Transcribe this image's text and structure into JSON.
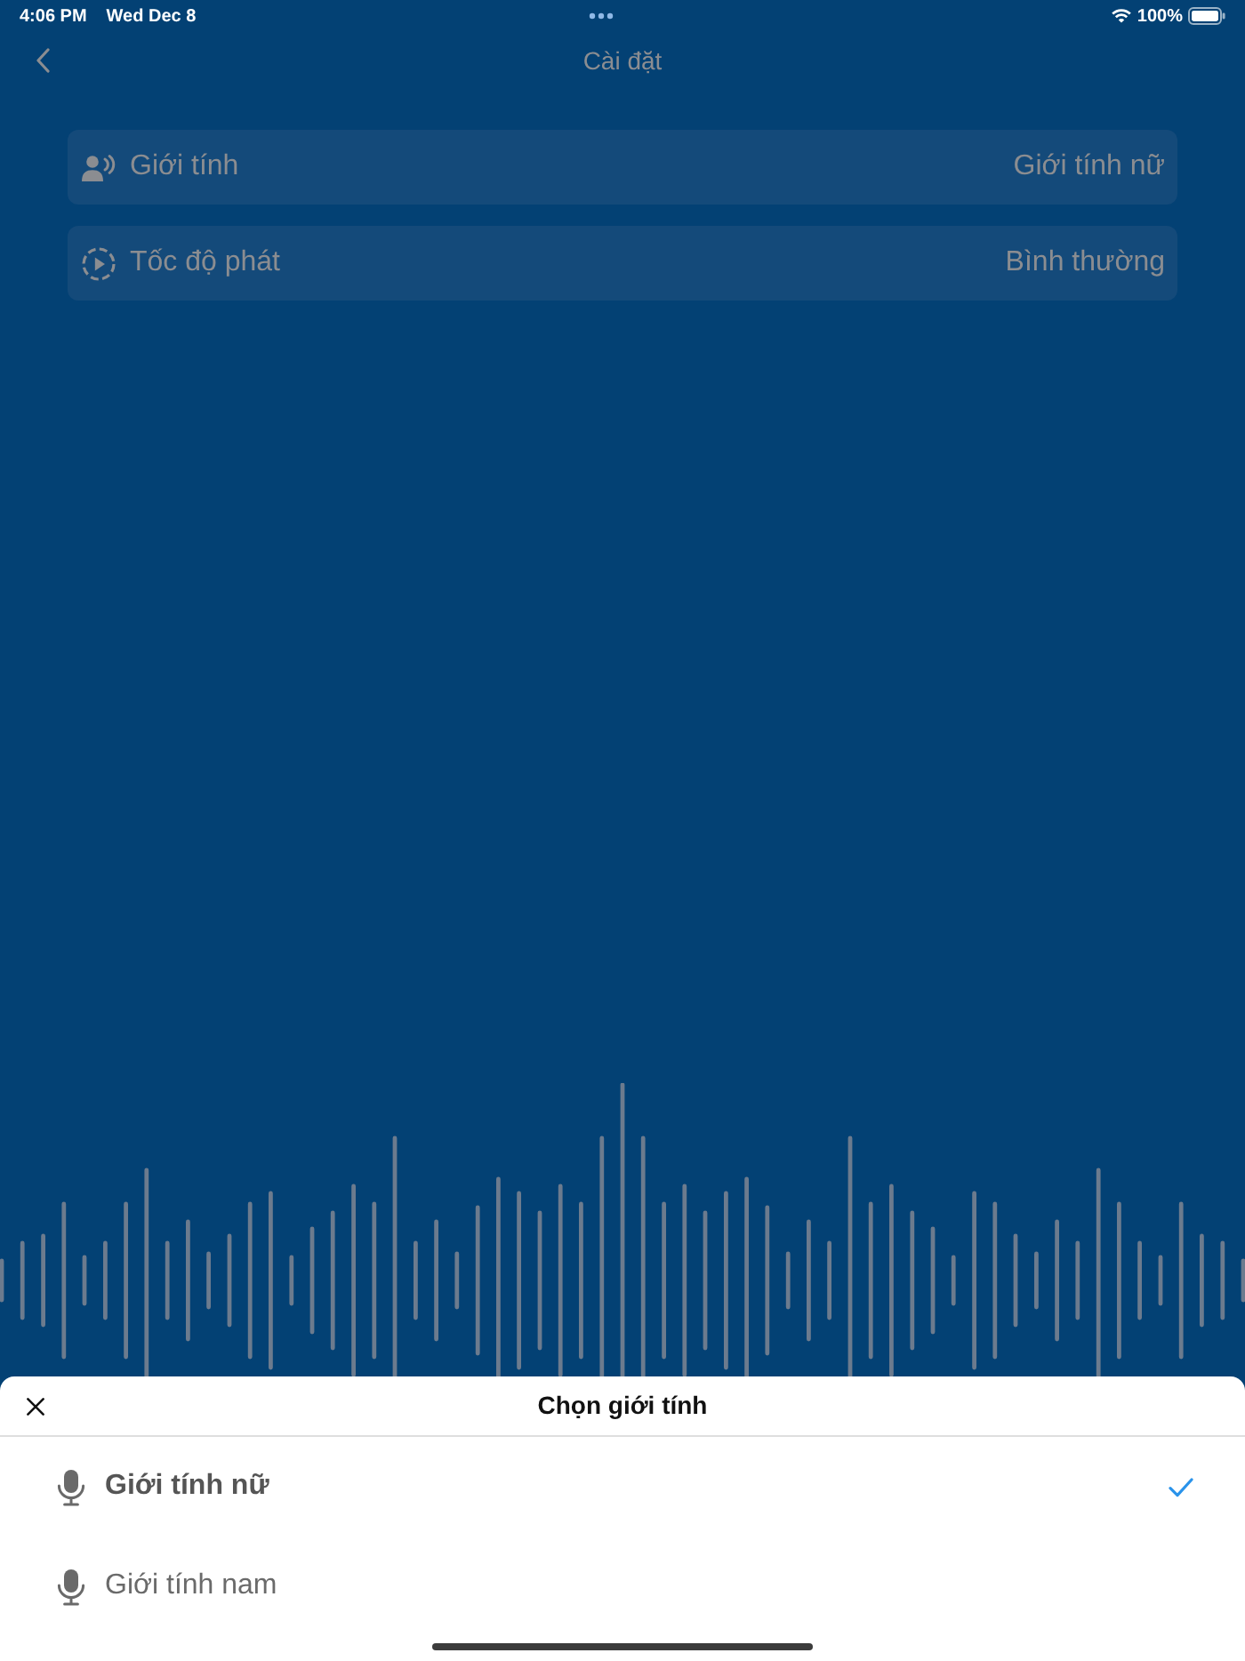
{
  "status_bar": {
    "time": "4:06 PM",
    "date": "Wed Dec 8",
    "battery": "100%"
  },
  "nav": {
    "title": "Cài đặt"
  },
  "settings": [
    {
      "kind": "voice",
      "label": "Giới tính",
      "value": "Giới tính nữ"
    },
    {
      "kind": "speed",
      "label": "Tốc độ phát",
      "value": "Bình thường"
    }
  ],
  "sheet": {
    "title": "Chọn giới tính",
    "options": [
      {
        "label": "Giới tính nữ",
        "selected": true
      },
      {
        "label": "Giới tính nam",
        "selected": false
      }
    ]
  }
}
